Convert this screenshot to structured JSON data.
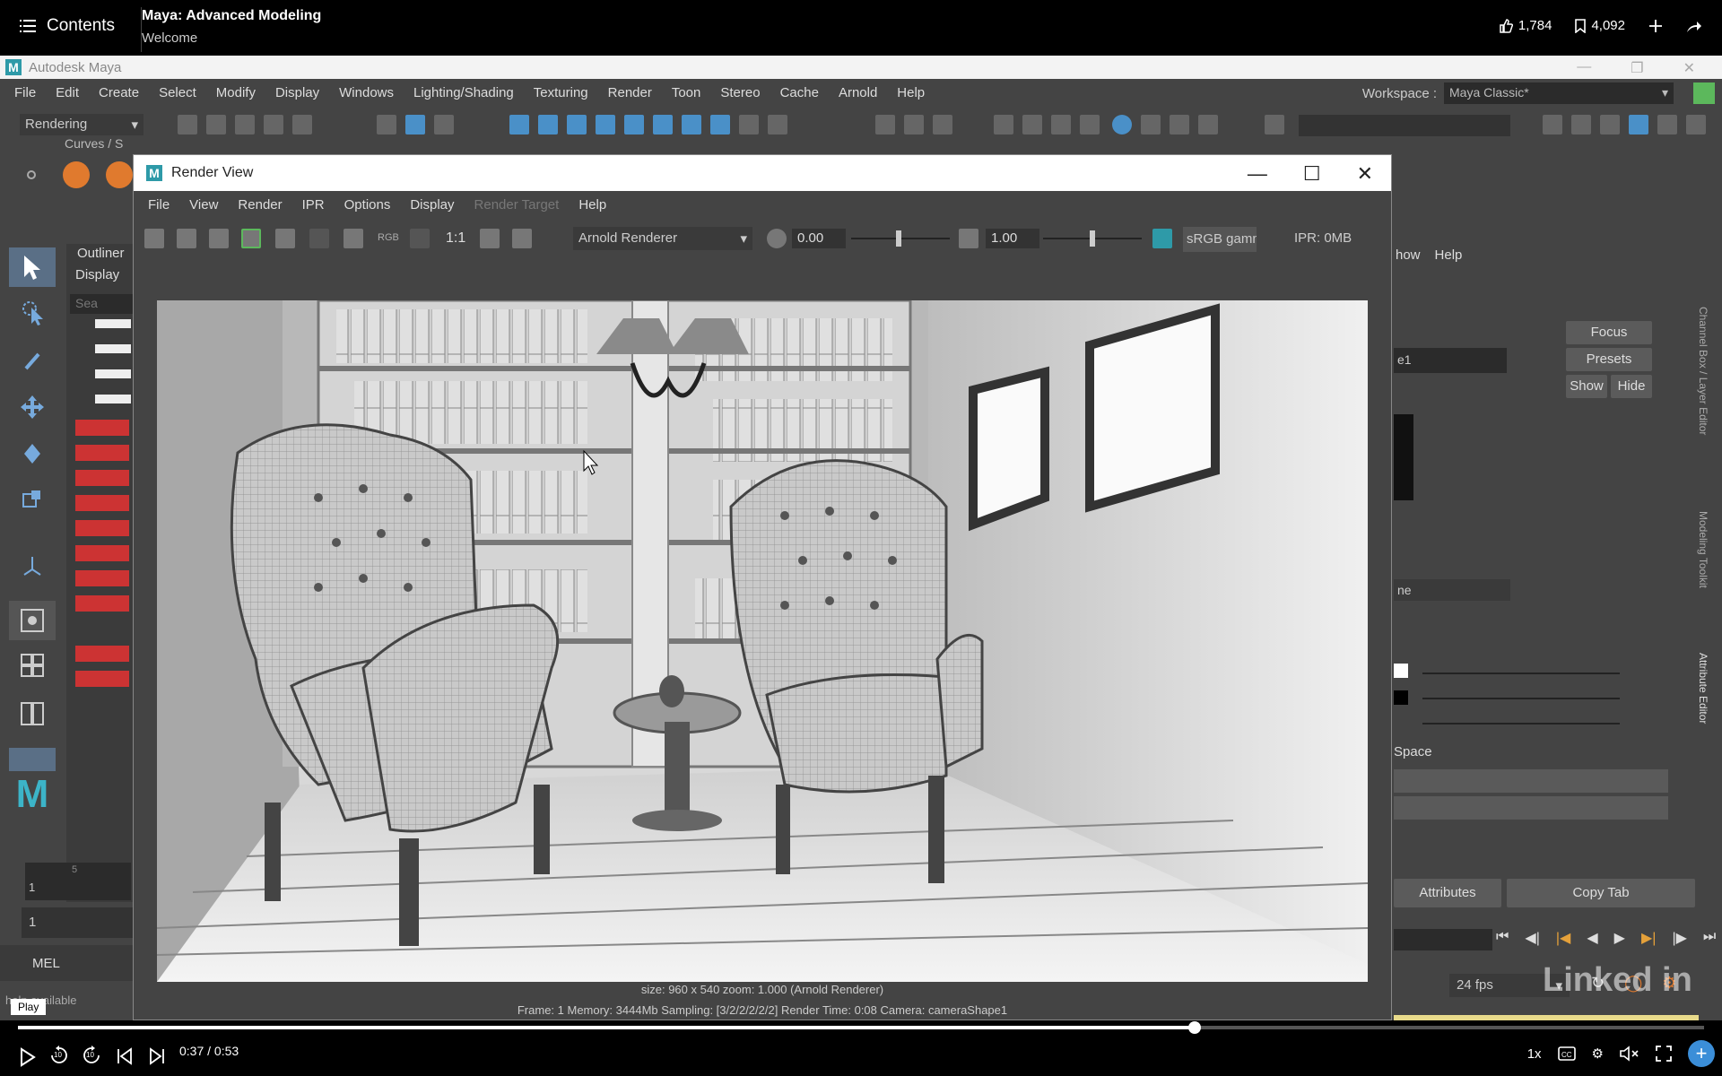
{
  "player": {
    "contents_label": "Contents",
    "course_title": "Maya: Advanced Modeling",
    "video_title": "Welcome",
    "likes": "1,784",
    "saves": "4,092",
    "time": "0:37 / 0:53",
    "progress": 0.698,
    "play_tooltip": "Play",
    "speed": "1x",
    "skip_back": "10",
    "skip_forward": "10"
  },
  "maya": {
    "window_title": "Autodesk Maya",
    "menu": [
      "File",
      "Edit",
      "Create",
      "Select",
      "Modify",
      "Display",
      "Windows",
      "Lighting/Shading",
      "Texturing",
      "Render",
      "Toon",
      "Stereo",
      "Cache",
      "Arnold",
      "Help"
    ],
    "workspace_label": "Workspace :",
    "workspace_value": "Maya Classic*",
    "mode": "Rendering",
    "shelf_tab": "Curves / S",
    "outliner_title": "Outliner",
    "outliner_display": "Display",
    "outliner_search": "Sea",
    "range_value": "1",
    "timeslider_start": "1",
    "timeslider_tick": "5",
    "mel_label": "MEL",
    "help_line": "help available",
    "ae": {
      "menu": [
        "how",
        "Help"
      ],
      "name_field": "e1",
      "focus": "Focus",
      "presets": "Presets",
      "show": "Show",
      "hide": "Hide",
      "dropdown": "ne",
      "space_label": "Space",
      "attributes": "Attributes",
      "copy_tab": "Copy Tab"
    },
    "fps": "24 fps",
    "side_tabs": [
      "Channel Box / Layer Editor",
      "Modeling Toolkit",
      "Attribute Editor"
    ]
  },
  "render_view": {
    "title": "Render View",
    "menu": [
      "File",
      "View",
      "Render",
      "IPR",
      "Options",
      "Display",
      "Render Target",
      "Help"
    ],
    "ratio_label": "1:1",
    "rgb_label": "RGB",
    "renderer": "Arnold Renderer",
    "exposure": "0.00",
    "gamma_value": "1.00",
    "colorspace": "sRGB gamm",
    "ipr_mem": "IPR: 0MB",
    "info_line1": "size: 960 x 540  zoom: 1.000     (Arnold Renderer)",
    "info_line2": "Frame: 1     Memory: 3444Mb     Sampling: [3/2/2/2/2/2]     Render Time: 0:08     Camera: cameraShape1"
  },
  "watermark": "Linked in",
  "colors": {
    "maya_bg": "#444444",
    "accent_blue": "#4a90c8",
    "timeline_yellow": "#e8da8a"
  }
}
